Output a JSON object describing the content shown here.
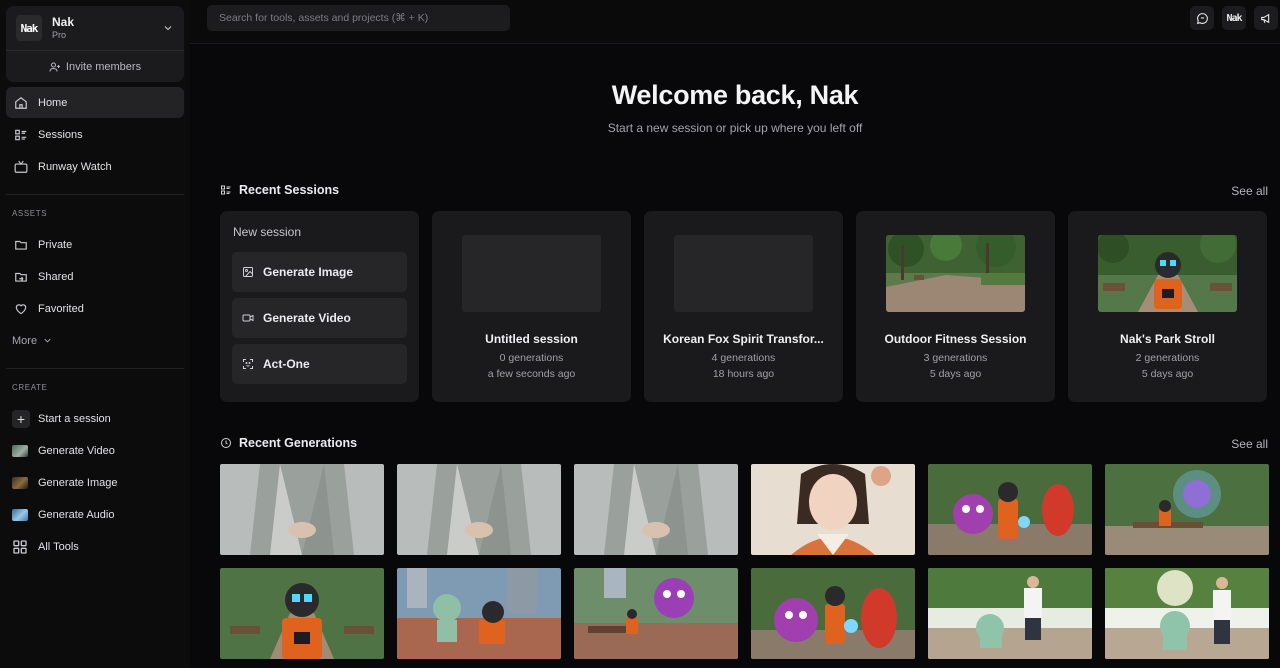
{
  "workspace": {
    "logo": "Nak",
    "name": "Nak",
    "plan": "Pro",
    "invite_label": "Invite members"
  },
  "nav": [
    {
      "label": "Home",
      "icon": "home-icon"
    },
    {
      "label": "Sessions",
      "icon": "sessions-icon"
    },
    {
      "label": "Runway Watch",
      "icon": "tv-icon"
    }
  ],
  "assets": {
    "heading": "ASSETS",
    "items": [
      {
        "label": "Private",
        "icon": "folder-icon"
      },
      {
        "label": "Shared",
        "icon": "shared-folder-icon"
      },
      {
        "label": "Favorited",
        "icon": "heart-icon"
      }
    ],
    "more_label": "More"
  },
  "create": {
    "heading": "CREATE",
    "items": [
      {
        "label": "Start a session",
        "icon": "plus-icon"
      },
      {
        "label": "Generate Video",
        "icon": "video-thumb-icon"
      },
      {
        "label": "Generate Image",
        "icon": "image-thumb-icon"
      },
      {
        "label": "Generate Audio",
        "icon": "audio-thumb-icon"
      },
      {
        "label": "All Tools",
        "icon": "grid-icon"
      }
    ]
  },
  "search": {
    "placeholder": "Search for tools, assets and projects (⌘ + K)"
  },
  "topbar": {
    "logo": "Nak"
  },
  "hero": {
    "title": "Welcome back, Nak",
    "subtitle": "Start a new session or pick up where you left off"
  },
  "recent_sessions": {
    "heading": "Recent Sessions",
    "see_all": "See all",
    "new_session": {
      "title": "New session",
      "buttons": [
        "Generate Image",
        "Generate Video",
        "Act-One"
      ]
    },
    "items": [
      {
        "title": "Untitled session",
        "generations": "0 generations",
        "time": "a few seconds ago",
        "thumb": "empty"
      },
      {
        "title": "Korean Fox Spirit Transfor...",
        "generations": "4 generations",
        "time": "18 hours ago",
        "thumb": "empty"
      },
      {
        "title": "Outdoor Fitness Session",
        "generations": "3 generations",
        "time": "5 days ago",
        "thumb": "park"
      },
      {
        "title": "Nak's Park Stroll",
        "generations": "2 generations",
        "time": "5 days ago",
        "thumb": "robot-park"
      }
    ]
  },
  "recent_generations": {
    "heading": "Recent Generations",
    "see_all": "See all",
    "items": [
      "robe-hands",
      "robe-hands",
      "robe-hands",
      "portrait-woman",
      "monster-robot-fight",
      "monster-bench",
      "robot-park",
      "robots-plaza",
      "monster-bench-plaza",
      "monster-robot-fight",
      "robot-man-park",
      "robot-man-park-2"
    ]
  }
}
